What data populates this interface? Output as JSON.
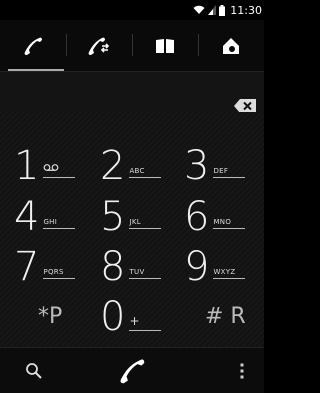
{
  "statusbar": {
    "time": "11:30",
    "icons": [
      "wifi-icon",
      "signal-icon",
      "battery-icon"
    ]
  },
  "tabs": [
    {
      "name": "dialer",
      "icon": "phone-icon",
      "active": true
    },
    {
      "name": "call-log",
      "icon": "call-log-icon",
      "active": false
    },
    {
      "name": "contacts",
      "icon": "contacts-book-icon",
      "active": false
    },
    {
      "name": "favorites",
      "icon": "star-house-icon",
      "active": false
    }
  ],
  "dial_field": {
    "value": "",
    "backspace_icon": "backspace-icon"
  },
  "keypad": {
    "rows": [
      [
        {
          "digit": "1",
          "letters": "",
          "icon": "voicemail-icon"
        },
        {
          "digit": "2",
          "letters": "ABC"
        },
        {
          "digit": "3",
          "letters": "DEF"
        }
      ],
      [
        {
          "digit": "4",
          "letters": "GHI"
        },
        {
          "digit": "5",
          "letters": "JKL"
        },
        {
          "digit": "6",
          "letters": "MNO"
        }
      ],
      [
        {
          "digit": "7",
          "letters": "PQRS"
        },
        {
          "digit": "8",
          "letters": "TUV"
        },
        {
          "digit": "9",
          "letters": "WXYZ"
        }
      ],
      [
        {
          "digit": "*P",
          "letters": ""
        },
        {
          "digit": "0",
          "letters": "+"
        },
        {
          "digit": "# R",
          "letters": ""
        }
      ]
    ]
  },
  "bottombar": {
    "search_icon": "search-icon",
    "call_icon": "call-icon",
    "menu_icon": "overflow-menu-icon"
  },
  "colors": {
    "background": "#000000",
    "tab_indicator": "#aaaaaa",
    "text": "#ffffff"
  }
}
